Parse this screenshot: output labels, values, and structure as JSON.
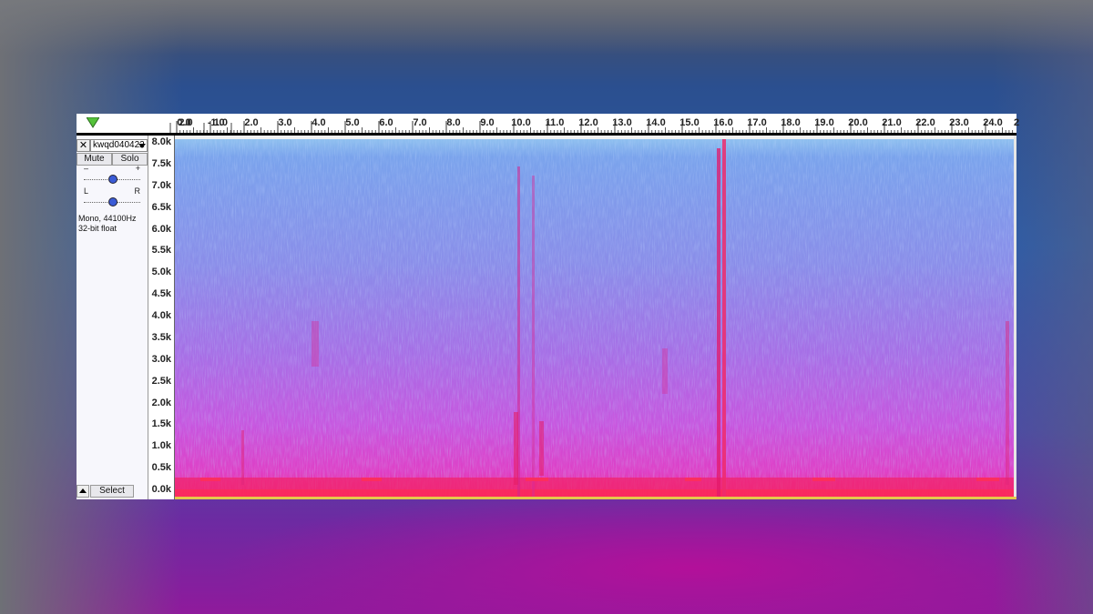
{
  "timeline": {
    "left_labels": [
      "2.0",
      "- 1.0"
    ],
    "seconds_labels": [
      "0.0",
      "1.0",
      "2.0",
      "3.0",
      "4.0",
      "5.0",
      "6.0",
      "7.0",
      "8.0",
      "9.0",
      "10.0",
      "11.0",
      "12.0",
      "13.0",
      "14.0",
      "15.0",
      "16.0",
      "17.0",
      "18.0",
      "19.0",
      "20.0",
      "21.0",
      "22.0",
      "23.0",
      "24.0",
      "2"
    ]
  },
  "track": {
    "name": "kwqd040422",
    "close_glyph": "✕",
    "mute_label": "Mute",
    "solo_label": "Solo",
    "gain_minus": "–",
    "gain_plus": "+",
    "gain_level": 0.5,
    "pan_left": "L",
    "pan_right": "R",
    "pan_level": 0.5,
    "info_line1": "Mono, 44100Hz",
    "info_line2": "32-bit float",
    "select_label": "Select"
  },
  "frequency_axis": {
    "labels": [
      "8.0k",
      "7.5k",
      "7.0k",
      "6.5k",
      "6.0k",
      "5.5k",
      "5.0k",
      "4.5k",
      "4.0k",
      "3.5k",
      "3.0k",
      "2.5k",
      "2.0k",
      "1.5k",
      "1.0k",
      "0.5k",
      "0.0k"
    ]
  },
  "icons": {
    "play_marker": "play-position-triangle-icon",
    "close": "close-icon",
    "dropdown": "chevron-down-icon",
    "collapse": "collapse-up-icon"
  },
  "colors": {
    "spectrogram_high": "#f0246e",
    "spectrogram_mid": "#c043e0",
    "spectrogram_low": "#79a6ec",
    "selection_bar": "#e5c84a",
    "play_marker": "#54c23a"
  }
}
